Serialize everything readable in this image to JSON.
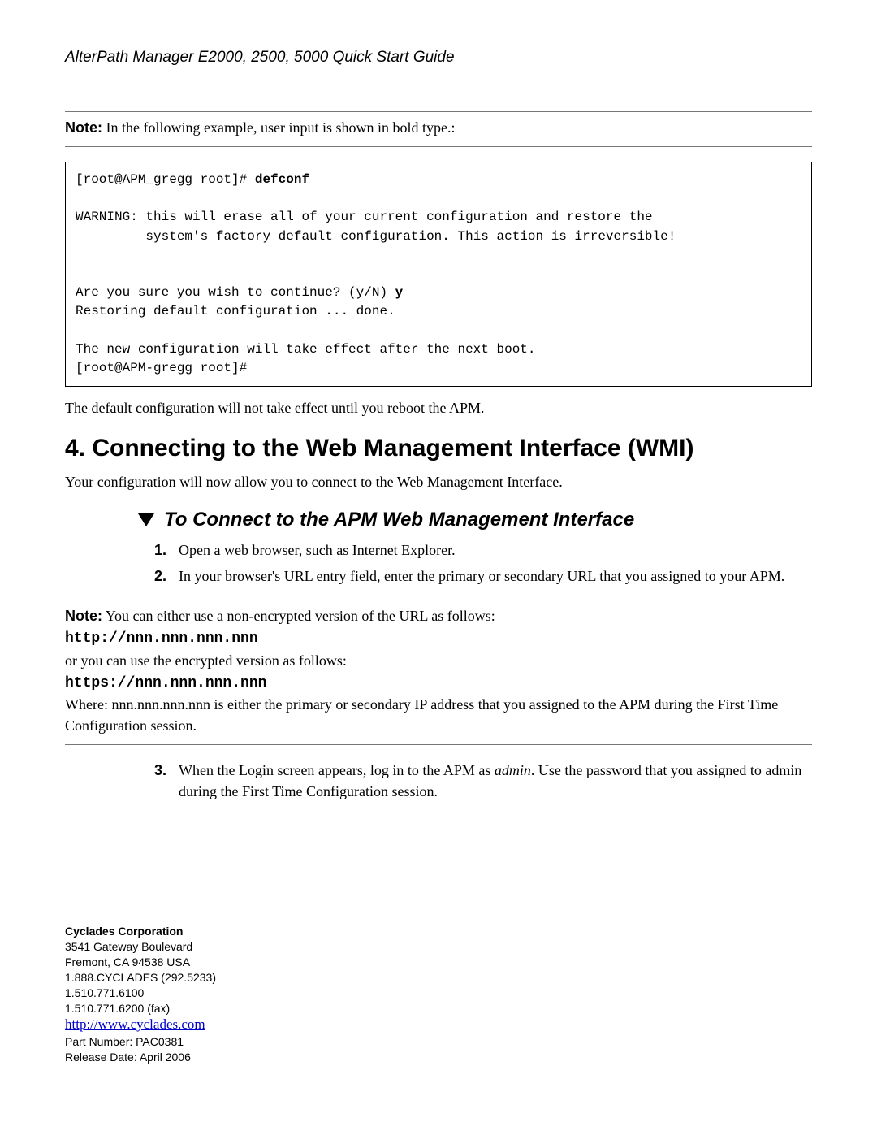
{
  "header": "AlterPath Manager E2000, 2500, 5000 Quick Start Guide",
  "note1": {
    "label": "Note:",
    "text": "In the following example, user input is shown in bold type.:"
  },
  "terminal": {
    "line1_prefix": "[root@APM_gregg root]# ",
    "line1_cmd": "defconf",
    "line2": "WARNING: this will erase all of your current configuration and restore the",
    "line3": "         system's factory default configuration. This action is irreversible!",
    "line4_prefix": "Are you sure you wish to continue? (y/N) ",
    "line4_cmd": "y",
    "line5": "Restoring default configuration ... done.",
    "line6": "The new configuration will take effect after the next boot.",
    "line7": "[root@APM-gregg root]#"
  },
  "after_terminal": "The default configuration will not take effect until you reboot the APM.",
  "section4_title": "4. Connecting to the Web Management Interface (WMI)",
  "section4_intro": "Your configuration will now allow you to connect to the Web Management Interface.",
  "subheading": "To Connect to the APM Web Management Interface",
  "steps": {
    "s1_num": "1.",
    "s1_text": "Open a web browser, such as Internet Explorer.",
    "s2_num": "2.",
    "s2_text": "In your browser's URL entry field, enter the primary or secondary URL that you assigned to your APM.",
    "s3_num": "3.",
    "s3_text_a": "When the Login screen appears, log in to the APM as ",
    "s3_text_b": "admin",
    "s3_text_c": ". Use the password that you assigned to admin during the First Time Configuration session."
  },
  "note2": {
    "label": "Note:",
    "line1": "You can either use a non-encrypted version of the URL as follows:",
    "url1": "http://nnn.nnn.nnn.nnn",
    "line2": "or you can use the encrypted version as follows:",
    "url2": "https://nnn.nnn.nnn.nnn",
    "line3": "Where: nnn.nnn.nnn.nnn is either the primary or secondary IP address that you assigned to the APM during the First Time Configuration session."
  },
  "footer": {
    "company": "Cyclades Corporation",
    "addr1": "3541 Gateway Boulevard",
    "addr2": "Fremont, CA 94538 USA",
    "phone1": "1.888.CYCLADES (292.5233)",
    "phone2": "1.510.771.6100",
    "phone3": "1.510.771.6200 (fax)",
    "url": "http://www.cyclades.com",
    "part": "Part Number: PAC0381",
    "release": "Release Date: April 2006"
  }
}
